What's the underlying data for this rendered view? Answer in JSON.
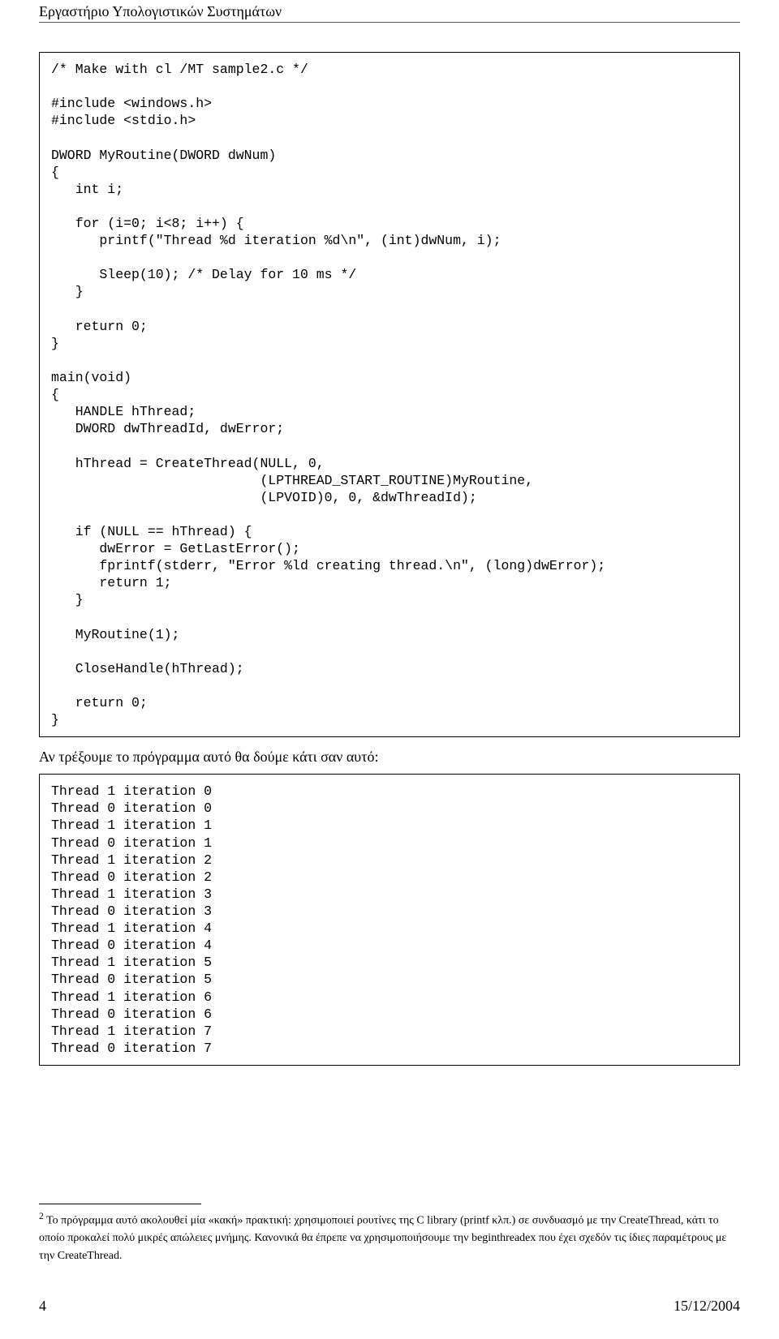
{
  "header": {
    "title": "Εργαστήριο Υπολογιστικών Συστημάτων"
  },
  "code": {
    "text": "/* Make with cl /MT sample2.c */\n\n#include <windows.h>\n#include <stdio.h>\n\nDWORD MyRoutine(DWORD dwNum)\n{\n   int i;\n\n   for (i=0; i<8; i++) {\n      printf(\"Thread %d iteration %d\\n\", (int)dwNum, i);\n\n      Sleep(10); /* Delay for 10 ms */\n   }\n\n   return 0;\n}\n\nmain(void)\n{\n   HANDLE hThread;\n   DWORD dwThreadId, dwError;\n\n   hThread = CreateThread(NULL, 0,\n                          (LPTHREAD_START_ROUTINE)MyRoutine,\n                          (LPVOID)0, 0, &dwThreadId);\n\n   if (NULL == hThread) {\n      dwError = GetLastError();\n      fprintf(stderr, \"Error %ld creating thread.\\n\", (long)dwError);\n      return 1;\n   }\n\n   MyRoutine(1);\n\n   CloseHandle(hThread);\n\n   return 0;\n}"
  },
  "para1": "Αν τρέξουμε το πρόγραμμα αυτό θα δούμε κάτι σαν αυτό:",
  "output": {
    "text": "Thread 1 iteration 0\nThread 0 iteration 0\nThread 1 iteration 1\nThread 0 iteration 1\nThread 1 iteration 2\nThread 0 iteration 2\nThread 1 iteration 3\nThread 0 iteration 3\nThread 1 iteration 4\nThread 0 iteration 4\nThread 1 iteration 5\nThread 0 iteration 5\nThread 1 iteration 6\nThread 0 iteration 6\nThread 1 iteration 7\nThread 0 iteration 7"
  },
  "footnote": {
    "marker": "2",
    "text": " Το πρόγραμμα αυτό ακολουθεί μία «κακή» πρακτική: χρησιμοποιεί ρουτίνες της C library (printf κλπ.) σε συνδυασμό με την CreateThread, κάτι το οποίο προκαλεί πολύ μικρές απώλειες μνήμης. Κανονικά θα έπρεπε να χρησιμοποιήσουμε την beginthreadex που έχει σχεδόν τις ίδιες παραμέτρους με την CreateThread."
  },
  "footer": {
    "page": "4",
    "date": "15/12/2004"
  }
}
